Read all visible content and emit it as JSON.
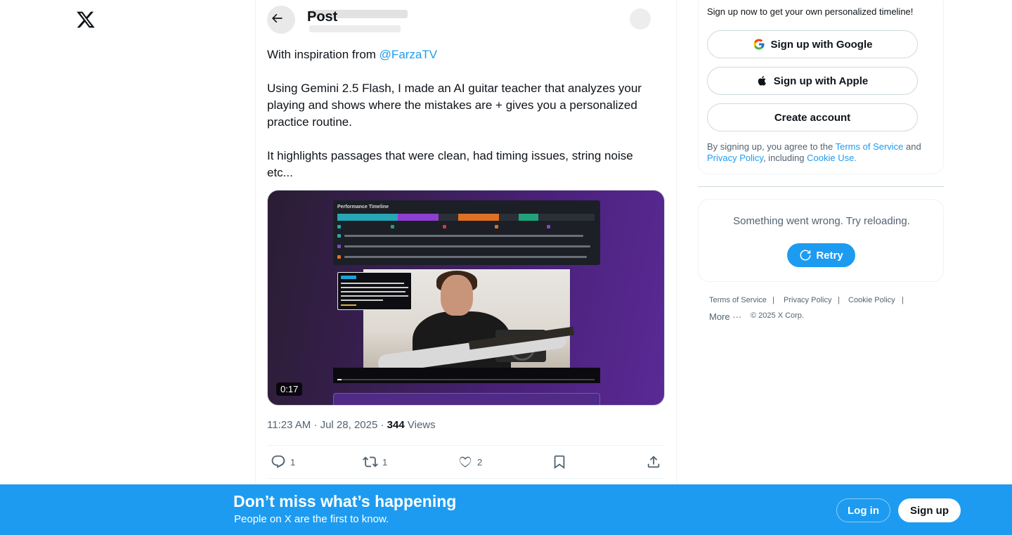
{
  "app": {
    "logo_icon": "x-logo-icon"
  },
  "header": {
    "title": "Post",
    "back_icon": "arrow-left-icon"
  },
  "post": {
    "paragraphs": [
      {
        "prefix": "With inspiration from ",
        "mention": "@FarzaTV"
      },
      {
        "text": "Using Gemini 2.5 Flash, I made an AI guitar teacher that analyzes your playing and shows where the mistakes are + gives you a personalized practice routine."
      },
      {
        "text": "It highlights passages that were clean, had timing issues, string noise etc..."
      }
    ],
    "media": {
      "duration": "0:17",
      "overlay_title": "Performance Timeline",
      "overlay_colors": [
        "#27a6b5",
        "#8e3fd1",
        "#e07023",
        "#20a47a"
      ]
    },
    "timestamp": "11:23 AM · Jul 28, 2025",
    "separator": " · ",
    "views_count": "344",
    "views_label": "Views",
    "actions": {
      "reply_count": "1",
      "repost_count": "1",
      "like_count": "2"
    }
  },
  "sidebar": {
    "signup_note": "Sign up now to get your own personalized timeline!",
    "google_label": "Sign up with Google",
    "apple_label": "Sign up with Apple",
    "create_label": "Create account",
    "legal_prefix": "By signing up, you agree to the ",
    "terms_link": "Terms of Service",
    "legal_and": " and ",
    "privacy_link": "Privacy Policy",
    "legal_including": ", including ",
    "cookie_link": "Cookie Use.",
    "error_text": "Something went wrong. Try reloading.",
    "retry_label": "Retry",
    "footer": {
      "terms": "Terms of Service",
      "privacy": "Privacy Policy",
      "cookie": "Cookie Policy",
      "more": "More",
      "copyright": "© 2025 X Corp."
    }
  },
  "banner": {
    "title": "Don’t miss what’s happening",
    "subtitle": "People on X are the first to know.",
    "login_label": "Log in",
    "signup_label": "Sign up"
  },
  "colors": {
    "accent": "#1d9bf0",
    "text_primary": "#0f1419",
    "text_secondary": "#536471"
  }
}
